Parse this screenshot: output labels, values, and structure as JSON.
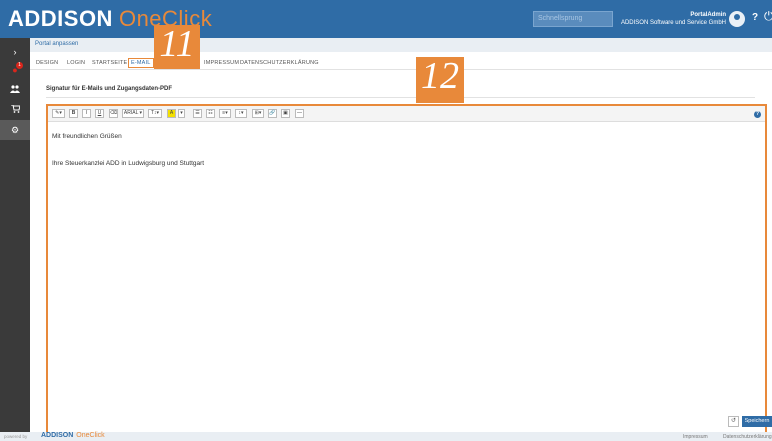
{
  "header": {
    "brand": "ADDISON",
    "brand_product": "OneClick",
    "search_placeholder": "Schnellsprung",
    "user_name": "PortalAdmin",
    "user_company": "ADDISON Software und Service GmbH",
    "help_label": "?",
    "power_label": "⏻"
  },
  "sidebar": {
    "items": [
      {
        "icon": "chevron-right-icon",
        "glyph": "›"
      },
      {
        "icon": "mandate-icon",
        "glyph": "●",
        "badge": "1"
      },
      {
        "icon": "users-icon",
        "glyph": "👥"
      },
      {
        "icon": "cart-icon",
        "glyph": "🛒"
      },
      {
        "icon": "settings-icon",
        "glyph": "⚙"
      }
    ]
  },
  "breadcrumb": "Portal anpassen",
  "tabs": [
    "DESIGN",
    "LOGIN",
    "STARTSEITE",
    "E-MAIL",
    "IMPRESSUM",
    "DATENSCHUTZERKLÄRUNG"
  ],
  "callouts": [
    "11",
    "12"
  ],
  "section_title": "Signatur für E-Mails und Zugangsdaten-PDF",
  "toolbar": {
    "buttons": [
      "✎▾",
      "B",
      "I",
      "U",
      "⌫",
      "ARIAL ▾",
      "T↕▾",
      "A",
      "▾",
      "☰",
      "☷",
      "≡▾",
      "↕▾",
      "⊞▾",
      "🔗",
      "▣",
      "—"
    ],
    "help": "?"
  },
  "editor": {
    "line1": "Mit freundlichen Grüßen",
    "line2": "Ihre Steuerkanzlei ADD in Ludwigsburg und Stuttgart"
  },
  "actions": {
    "reset_glyph": "↺",
    "save_label": "Speichern"
  },
  "footer": {
    "powered_by": "powered by",
    "brand": "ADDISON",
    "brand_product": "OneClick",
    "link1": "Impressum",
    "link2": "Datenschutzerklärung"
  }
}
